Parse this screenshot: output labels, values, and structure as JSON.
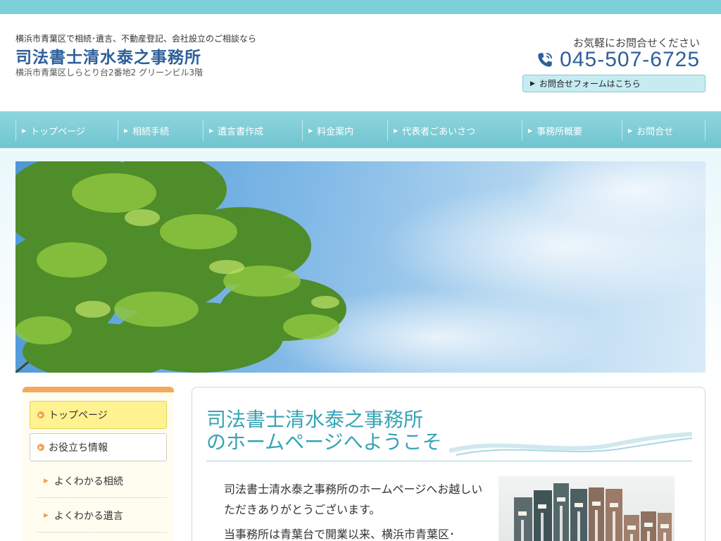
{
  "header": {
    "tagline": "横浜市青葉区で相続･遺言、不動産登記、会社設立のご相談なら",
    "office_name": "司法書士清水泰之事務所",
    "address": "横浜市青葉区しらとり台2番地2 グリーンビル3階",
    "contact_caption": "お気軽にお問合せください",
    "phone": "045-507-6725",
    "form_button": "お問合せフォームはこちら"
  },
  "nav": {
    "items": [
      {
        "label": "トップページ"
      },
      {
        "label": "相続手続"
      },
      {
        "label": "遺言書作成"
      },
      {
        "label": "料金案内"
      },
      {
        "label": "代表者ごあいさつ"
      },
      {
        "label": "事務所概要"
      },
      {
        "label": "お問合せ"
      }
    ]
  },
  "sidebar": {
    "top_page": "トップページ",
    "section": "お役立ち情報",
    "sub_items": [
      {
        "label": "よくわかる相続"
      },
      {
        "label": "よくわかる遺言"
      }
    ]
  },
  "main": {
    "welcome_line1": "司法書士清水泰之事務所",
    "welcome_line2": "のホームページへようこそ",
    "intro_p1": "司法書士清水泰之事務所のホームページへお越しいただきありがとうございます。",
    "intro_p2": "当事務所は青葉台で開業以来、横浜市青葉区･"
  },
  "colors": {
    "accent": "#7dd0d8",
    "brand": "#2d5f9a",
    "welcome": "#36a3b5",
    "sidebar_accent": "#f6a85a"
  }
}
